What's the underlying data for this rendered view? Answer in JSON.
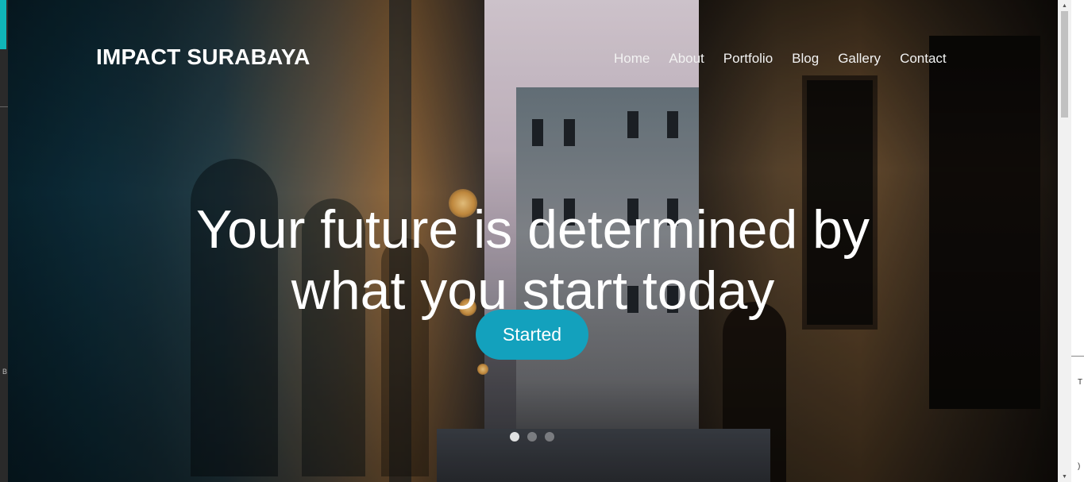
{
  "brand": {
    "name": "IMPACT SURABAYA"
  },
  "nav": {
    "items": [
      {
        "label": "Home"
      },
      {
        "label": "About"
      },
      {
        "label": "Portfolio"
      },
      {
        "label": "Blog"
      },
      {
        "label": "Gallery"
      },
      {
        "label": "Contact"
      }
    ]
  },
  "hero": {
    "headline_line1": "Your future is determined by",
    "headline_line2": "what you start today",
    "cta_label": "Started",
    "slides": {
      "count": 3,
      "active": 1
    }
  },
  "edges": {
    "left_letter": "B",
    "right_text_1": "T",
    "right_text_2": ")"
  },
  "colors": {
    "accent": "#13a1bd",
    "nav_text": "#f2f2f2",
    "brand_text": "#ffffff"
  }
}
